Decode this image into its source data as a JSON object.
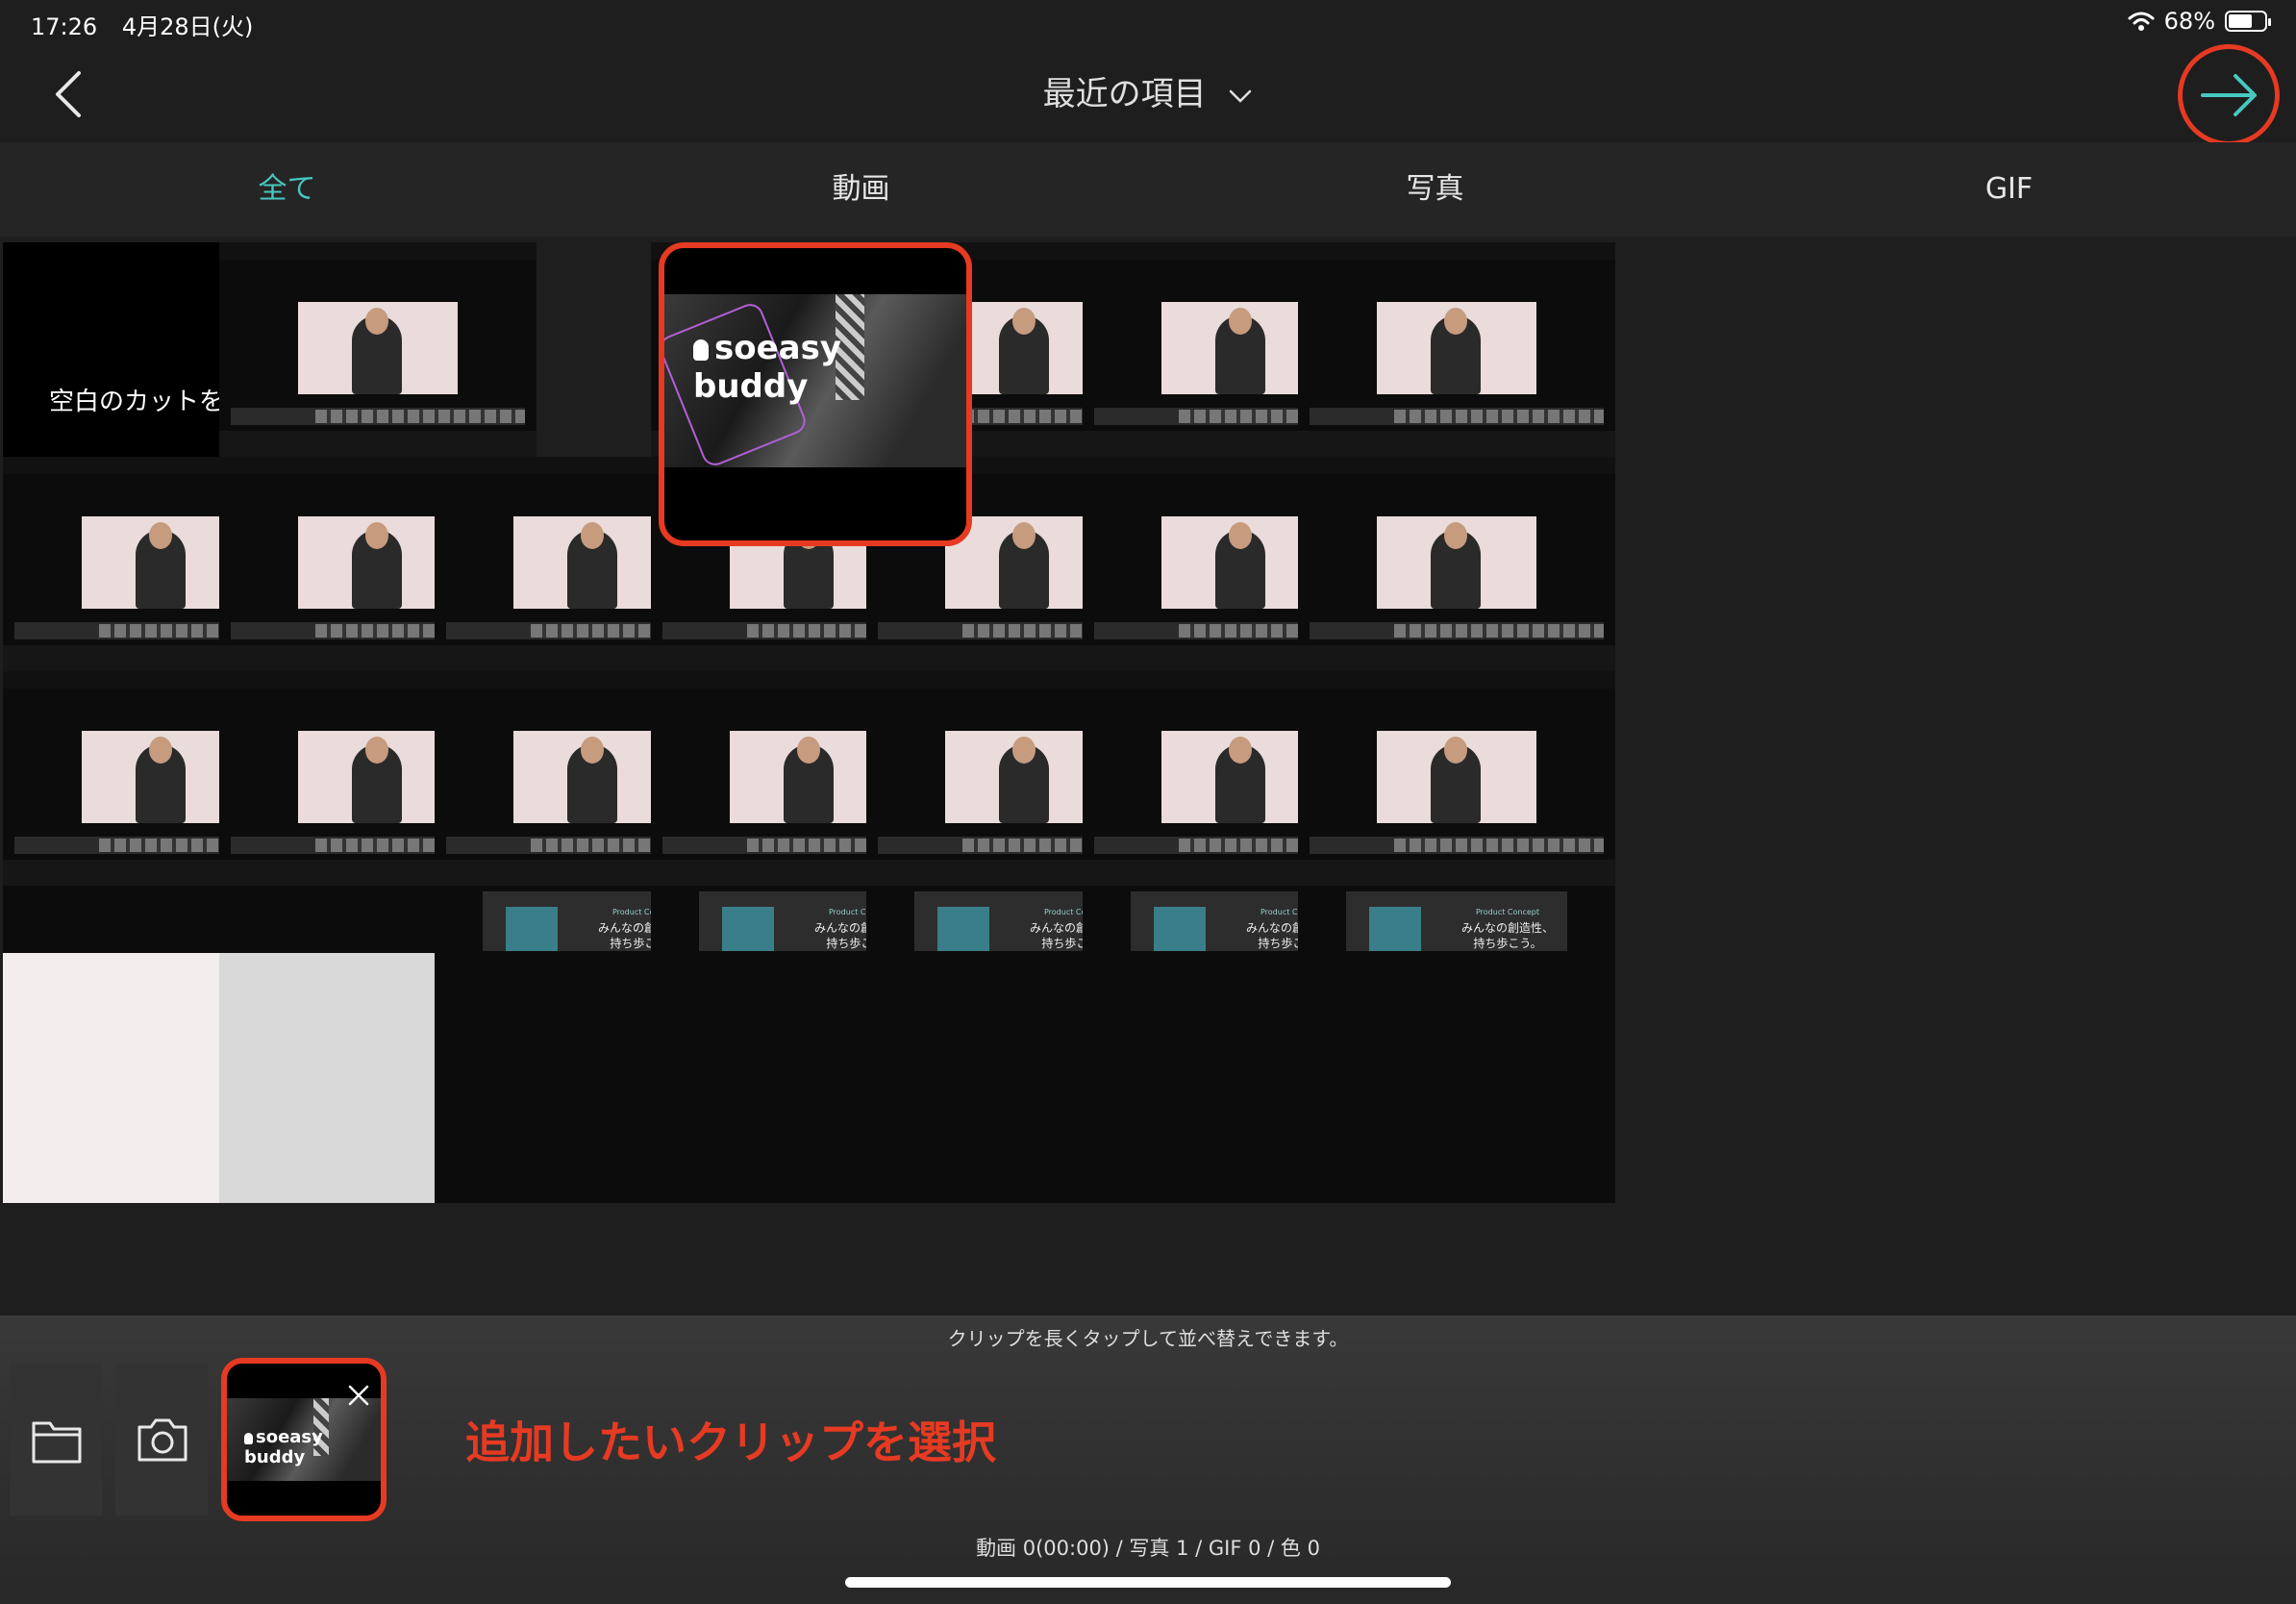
{
  "status_bar": {
    "time": "17:26",
    "date": "4月28日(火)",
    "battery": "68%",
    "battery_level": 0.68
  },
  "nav": {
    "title": "最近の項目",
    "back_icon": "chevron-left-icon",
    "next_icon": "arrow-right-icon",
    "accent": "#46c8c0",
    "highlight_color": "#e63a22"
  },
  "tabs": [
    {
      "label": "全て",
      "active": true
    },
    {
      "label": "動画",
      "active": false
    },
    {
      "label": "写真",
      "active": false
    },
    {
      "label": "GIF",
      "active": false
    }
  ],
  "grid": {
    "insert_blank_label": "空白のカットを挿入",
    "selected_thumb_text": "soeasy buddy",
    "promo_text_line1": "みんなの創造性、",
    "promo_text_line2": "持ち歩こう。",
    "promo_caption": "Product Concept"
  },
  "tray": {
    "hint": "クリップを長くタップして並べ替えできます。",
    "annotation": "追加したいクリップを選択",
    "clip_text": "soeasy buddy",
    "count": "動画 0(00:00) / 写真 1 / GIF 0 / 色 0",
    "folder_icon": "folder-icon",
    "camera_icon": "camera-icon",
    "close_icon": "close-icon"
  }
}
